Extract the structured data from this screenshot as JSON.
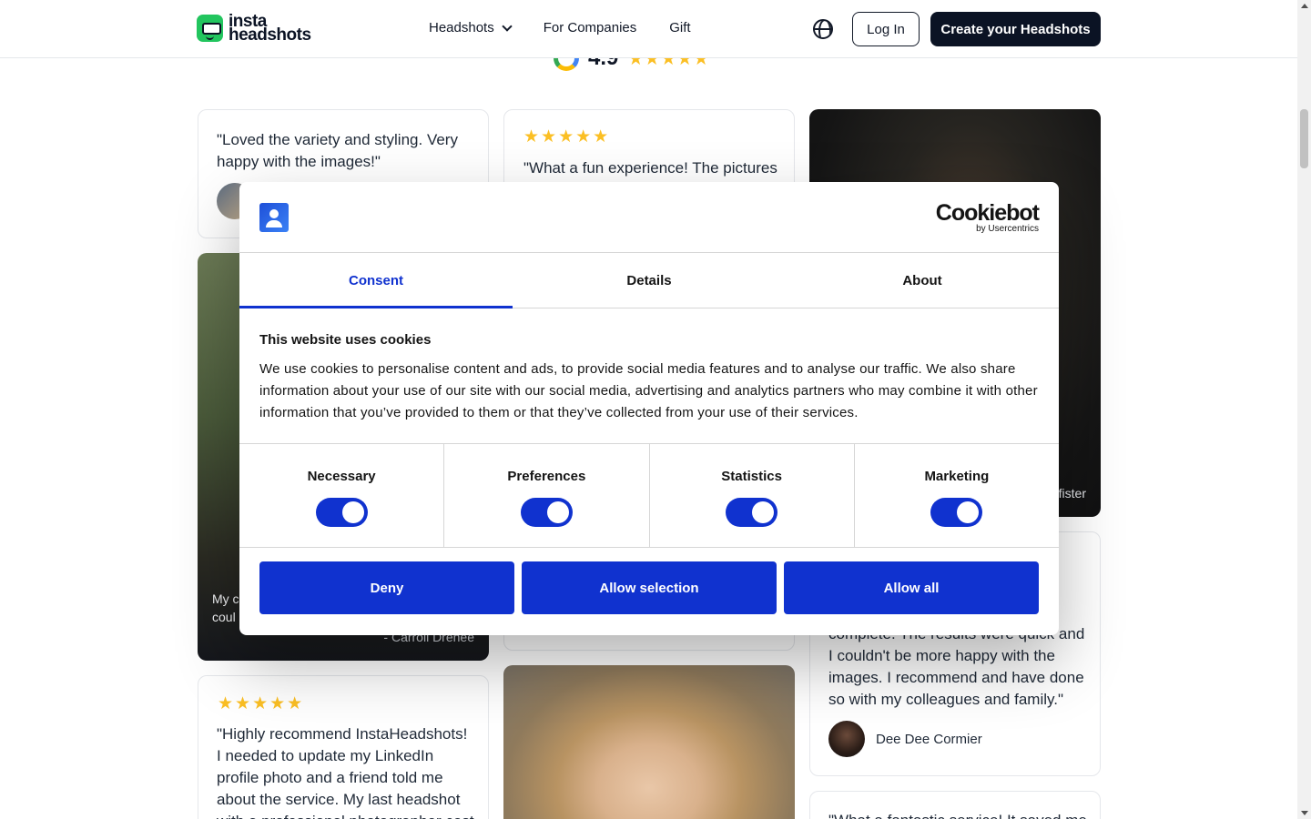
{
  "header": {
    "logo_top": "insta",
    "logo_bottom": "headshots",
    "nav": [
      {
        "label": "Headshots"
      },
      {
        "label": "For Companies"
      },
      {
        "label": "Gift"
      }
    ],
    "login_label": "Log In",
    "create_label": "Create your Headshots"
  },
  "rating": {
    "value": "4.9",
    "stars": "★★★★★"
  },
  "testimonials": {
    "card1_quote": "\"Loved the variety and styling. Very happy with the images!\"",
    "card2_stars": "★★★★★",
    "card2_quote": "\"What a fun experience! The pictures",
    "card3_caption": "fister",
    "card4_caption_a": "My c",
    "card4_caption_b": "coul",
    "card4_author": "- Carroll Drenee",
    "card5_quote": "complete. The results were quick and I couldn't be more happy with the images. I recommend and have done so with my colleagues and family.\"",
    "card5_author": "Dee Dee Cormier",
    "card6_stars": "★★★★★",
    "card6_quote": "\"Highly recommend InstaHeadshots! I needed to update my LinkedIn profile photo and a friend told me about the service. My last headshot with a professional photographer cost",
    "card7_quote": "\"What a fantastic service! It saved me"
  },
  "cookie_dialog": {
    "brand_name": "Cookiebot",
    "brand_by": "by Usercentrics",
    "tabs": [
      {
        "label": "Consent"
      },
      {
        "label": "Details"
      },
      {
        "label": "About"
      }
    ],
    "title": "This website uses cookies",
    "text": "We use cookies to personalise content and ads, to provide social media features and to analyse our traffic. We also share information about your use of our site with our social media, advertising and analytics partners who may combine it with other information that you’ve provided to them or that they’ve collected from your use of their services.",
    "toggles": [
      {
        "label": "Necessary",
        "on": true
      },
      {
        "label": "Preferences",
        "on": true
      },
      {
        "label": "Statistics",
        "on": true
      },
      {
        "label": "Marketing",
        "on": true
      }
    ],
    "buttons": {
      "deny": "Deny",
      "allow_selection": "Allow selection",
      "allow_all": "Allow all"
    }
  },
  "colors": {
    "accent": "#1032cf",
    "brand_dark": "#0b1324",
    "star": "#fbbf24",
    "logo_green": "#22c55e"
  }
}
